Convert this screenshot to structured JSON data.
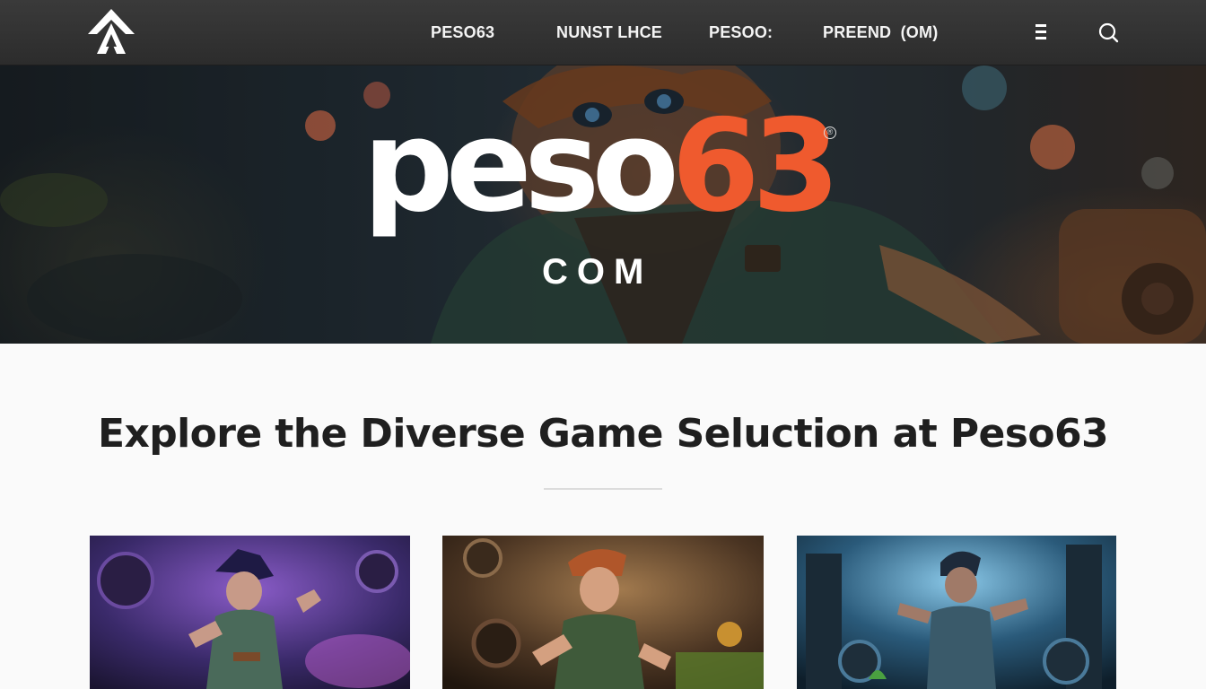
{
  "nav": {
    "links": [
      {
        "label_main": "PESO",
        "label_accent": "63"
      },
      {
        "label": "NUNST LHCE"
      },
      {
        "label": "PESOO:"
      },
      {
        "label": "PREEND  (OM)"
      }
    ],
    "icons": [
      "logo-icon",
      "menu-icon",
      "search-icon"
    ]
  },
  "hero": {
    "brand_main": "peso",
    "brand_number": "63",
    "brand_reg": "®",
    "brand_suffix": "COM"
  },
  "content": {
    "title": "Explore the Diverse Game Seluction at Peso63",
    "cards": [
      {
        "theme": "purple",
        "icon": "game-card-image"
      },
      {
        "theme": "amber",
        "icon": "game-card-image"
      },
      {
        "theme": "blue",
        "icon": "game-card-image"
      }
    ]
  },
  "colors": {
    "nav_bg": "#333333",
    "accent": "#ef5a2e",
    "title": "#1f1f1f"
  }
}
